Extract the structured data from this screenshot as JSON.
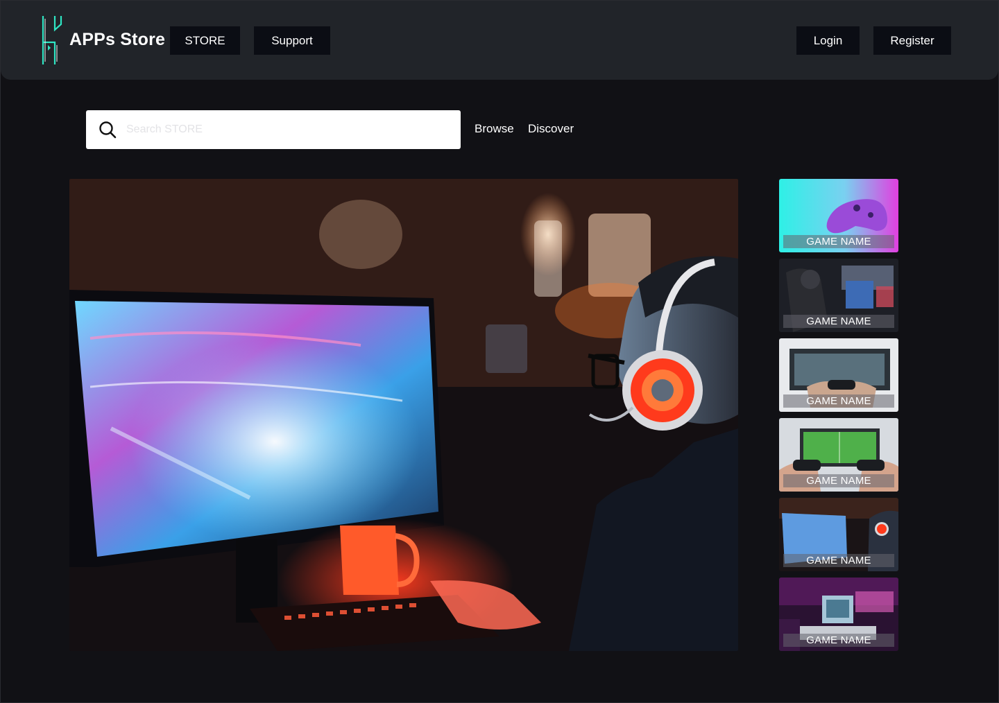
{
  "header": {
    "brand": "APPs Store",
    "nav": {
      "store": "STORE",
      "support": "Support"
    },
    "auth": {
      "login": "Login",
      "register": "Register"
    }
  },
  "search": {
    "placeholder": "Search STORE",
    "value": "",
    "links": {
      "browse": "Browse",
      "discover": "Discover"
    }
  },
  "hero": {
    "icon": "gamer-photo"
  },
  "sidebar": {
    "items": [
      {
        "label": "GAME NAME",
        "icon": "controller-photo"
      },
      {
        "label": "GAME NAME",
        "icon": "esports-photo"
      },
      {
        "label": "GAME NAME",
        "icon": "console-gaming-photo"
      },
      {
        "label": "GAME NAME",
        "icon": "football-game-photo"
      },
      {
        "label": "GAME NAME",
        "icon": "gamer-headset-photo"
      },
      {
        "label": "GAME NAME",
        "icon": "retro-computer-photo"
      }
    ]
  },
  "colors": {
    "page_bg": "#111115",
    "header_bg": "#212429",
    "button_bg": "#0b0d14",
    "logo_accent": "#2fe6c4"
  }
}
